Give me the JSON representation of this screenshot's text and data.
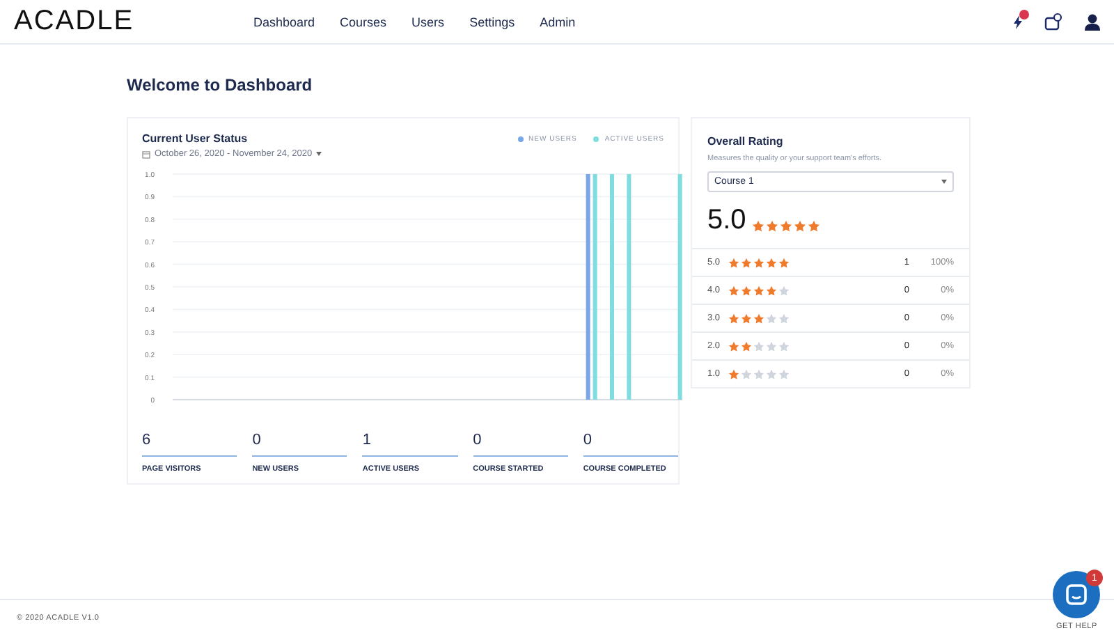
{
  "header": {
    "logo": "ACADLE",
    "nav": [
      {
        "label": "Dashboard"
      },
      {
        "label": "Courses"
      },
      {
        "label": "Users"
      },
      {
        "label": "Settings"
      },
      {
        "label": "Admin"
      }
    ],
    "notification_badge": true
  },
  "page_title": "Welcome to Dashboard",
  "user_status": {
    "title": "Current User Status",
    "date_range": "October 26, 2020 - November 24, 2020",
    "chart_data": {
      "type": "bar",
      "grid": true,
      "ylim": [
        0,
        1
      ],
      "yticks": [
        {
          "value": 0,
          "label": "0"
        },
        0.1,
        0.2,
        0.3,
        0.4,
        0.5,
        0.6,
        0.7,
        0.8,
        0.9,
        {
          "value": 1,
          "label": "1.0"
        }
      ],
      "series": [
        {
          "name": "NEW USERS",
          "color": "#7aa6e8",
          "values": [
            0,
            0,
            0,
            0,
            0,
            0,
            0,
            0,
            0,
            0,
            0,
            0,
            0,
            0,
            0,
            0,
            0,
            0,
            0,
            0,
            0,
            0,
            0,
            0,
            1,
            0,
            0,
            0,
            0,
            0
          ]
        },
        {
          "name": "ACTIVE USERS",
          "color": "#7fdde0",
          "values": [
            0,
            0,
            0,
            0,
            0,
            0,
            0,
            0,
            0,
            0,
            0,
            0,
            0,
            0,
            0,
            0,
            0,
            0,
            0,
            0,
            0,
            0,
            0,
            0,
            1,
            1,
            1,
            0,
            0,
            1
          ]
        }
      ]
    },
    "stats": [
      {
        "value": "6",
        "label": "PAGE VISITORS"
      },
      {
        "value": "0",
        "label": "NEW USERS"
      },
      {
        "value": "1",
        "label": "ACTIVE USERS"
      },
      {
        "value": "0",
        "label": "COURSE STARTED"
      },
      {
        "value": "0",
        "label": "COURSE COMPLETED"
      }
    ]
  },
  "overall_rating": {
    "title": "Overall Rating",
    "subtitle": "Measures the quality or your support team's efforts.",
    "course_select": "Course 1",
    "score": "5.0",
    "stars": 5,
    "rows": [
      {
        "rating": "5.0",
        "stars": 5,
        "count": "1",
        "percent": "100%"
      },
      {
        "rating": "4.0",
        "stars": 4,
        "count": "0",
        "percent": "0%"
      },
      {
        "rating": "3.0",
        "stars": 3,
        "count": "0",
        "percent": "0%"
      },
      {
        "rating": "2.0",
        "stars": 2,
        "count": "0",
        "percent": "0%"
      },
      {
        "rating": "1.0",
        "stars": 1,
        "count": "0",
        "percent": "0%"
      }
    ]
  },
  "footer": {
    "copyright": "© 2020 ACADLE V1.0",
    "help_link": "GET HELP",
    "chat_badge": "1"
  }
}
